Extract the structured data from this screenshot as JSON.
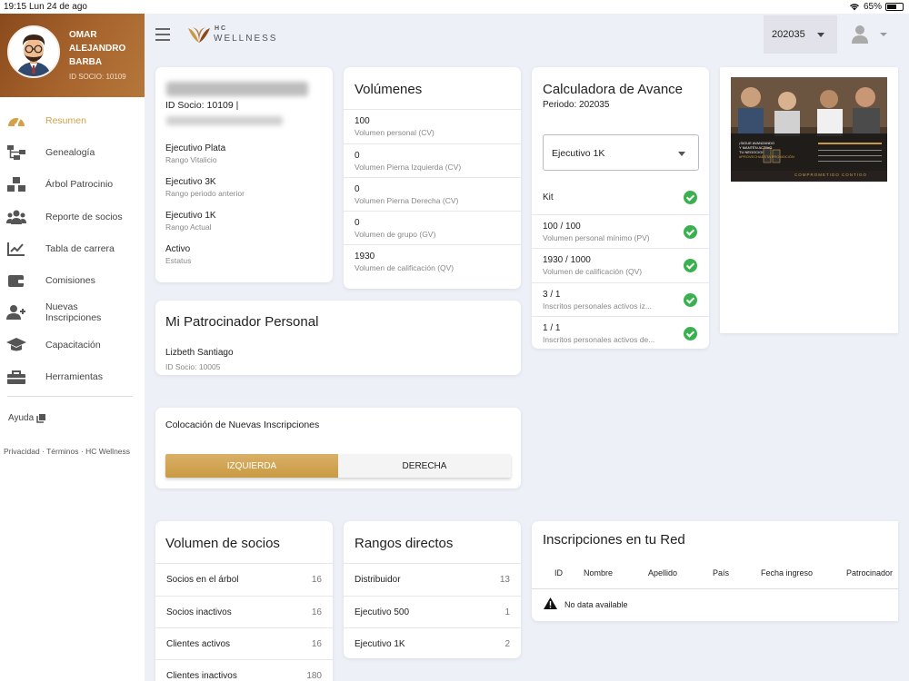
{
  "status_bar": {
    "time": "19:15",
    "date": "Lun 24 de ago",
    "battery": "65%",
    "battery_level": 0.65
  },
  "profile": {
    "name": "OMAR ALEJANDRO BARBA",
    "id_label": "ID SOCIO: 10109"
  },
  "nav": {
    "items": [
      {
        "label": "Resumen",
        "icon": "speedometer-icon",
        "active": true
      },
      {
        "label": "Genealogía",
        "icon": "hierarchy-icon"
      },
      {
        "label": "Árbol Patrocinio",
        "icon": "boxes-icon"
      },
      {
        "label": "Reporte de socios",
        "icon": "users-icon"
      },
      {
        "label": "Tabla de carrera",
        "icon": "chart-line-icon"
      },
      {
        "label": "Comisiones",
        "icon": "wallet-icon"
      },
      {
        "label": "Nuevas Inscripciones",
        "icon": "user-plus-icon"
      },
      {
        "label": "Capacitación",
        "icon": "graduation-cap-icon"
      },
      {
        "label": "Herramientas",
        "icon": "toolbox-icon"
      }
    ],
    "help": "Ayuda",
    "legal": "Privacidad · Términos · HC Wellness"
  },
  "brand": {
    "hc": "HC",
    "wellness": "WELLNESS",
    "accent": "#c99a44"
  },
  "header": {
    "period": "202035"
  },
  "member": {
    "id_line": "ID Socio: 10109 |",
    "rows": [
      {
        "title": "Ejecutivo Plata",
        "sub": "Rango Vitalicio"
      },
      {
        "title": "Ejecutivo 3K",
        "sub": "Rango periodo anterior"
      },
      {
        "title": "Ejecutivo 1K",
        "sub": "Rango Actual"
      },
      {
        "title": "Activo",
        "sub": "Estatus"
      }
    ]
  },
  "volumes": {
    "title": "Volúmenes",
    "rows": [
      {
        "value": "100",
        "label": "Volumen personal (CV)"
      },
      {
        "value": "0",
        "label": "Volumen Pierna Izquierda (CV)"
      },
      {
        "value": "0",
        "label": "Volumen Pierna Derecha (CV)"
      },
      {
        "value": "0",
        "label": "Volumen de grupo (GV)"
      },
      {
        "value": "1930",
        "label": "Volumen de calificación (QV)"
      }
    ]
  },
  "calculator": {
    "title": "Calculadora de Avance",
    "period": "Periodo: 202035",
    "rank_selected": "Ejecutivo 1K",
    "kit": "Kit",
    "rows": [
      {
        "value": "100 / 100",
        "label": "Volumen personal mínimo (PV)"
      },
      {
        "value": "1930 / 1000",
        "label": "Volumen de calificación (QV)"
      },
      {
        "value": "3 / 1",
        "label": "Inscritos personales activos iz..."
      },
      {
        "value": "1 / 1",
        "label": "Inscritos personales activos de..."
      }
    ]
  },
  "promo": {
    "lines": [
      "¡SIGUE AVANZANDO",
      "Y MANTÉN ACTIVO",
      "TU NEGOCIO!",
      "#PROVECHAESTA PROMOCIÓN"
    ],
    "footer": "COMPROMETIDO CONTIGO"
  },
  "sponsor": {
    "title": "Mi Patrocinador Personal",
    "name": "Lizbeth Santiago",
    "id": "ID Socio: 10005"
  },
  "placement": {
    "title": "Colocación de Nuevas Inscripciones",
    "left": "IZQUIERDA",
    "right": "DERECHA"
  },
  "partner_volume": {
    "title": "Volumen de socios",
    "rows": [
      {
        "label": "Socios en el árbol",
        "value": "16"
      },
      {
        "label": "Socios inactivos",
        "value": "16"
      },
      {
        "label": "Clientes activos",
        "value": "16"
      },
      {
        "label": "Clientes inactivos",
        "value": "180"
      }
    ]
  },
  "direct_ranks": {
    "title": "Rangos directos",
    "rows": [
      {
        "label": "Distribuidor",
        "value": "13"
      },
      {
        "label": "Ejecutivo 500",
        "value": "1"
      },
      {
        "label": "Ejecutivo 1K",
        "value": "2"
      }
    ]
  },
  "network": {
    "title": "Inscripciones en tu Red",
    "columns": [
      "ID",
      "Nombre",
      "Apellido",
      "País",
      "Fecha ingreso",
      "Patrocinador"
    ],
    "empty": "No data available"
  }
}
